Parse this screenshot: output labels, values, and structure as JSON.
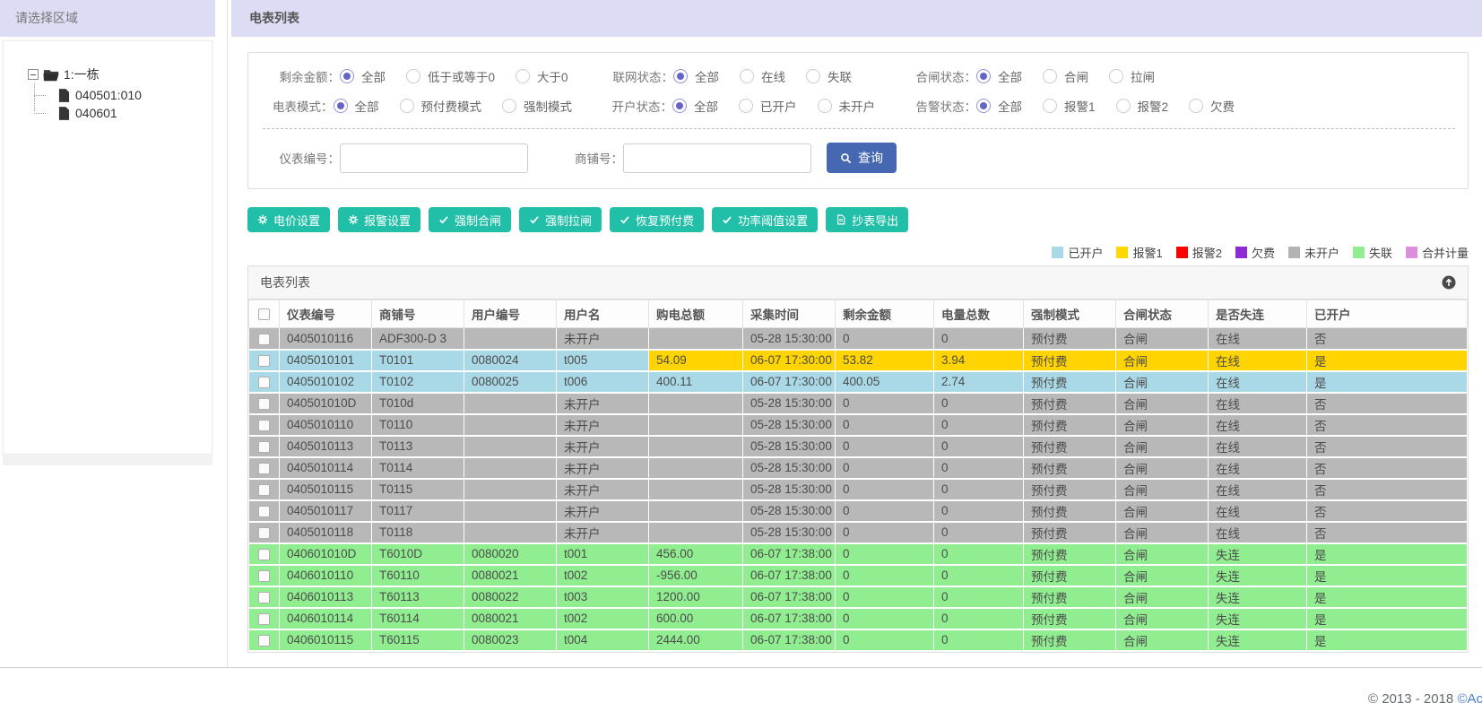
{
  "sidebar": {
    "title": "请选择区域",
    "tree": {
      "root_label": "1:一栋",
      "children": [
        "040501:010",
        "040601"
      ]
    }
  },
  "main_header": {
    "title": "电表列表"
  },
  "filters": {
    "groups": [
      {
        "label": "剩余金额：",
        "options": [
          "全部",
          "低于或等于0",
          "大于0"
        ],
        "selected": 0
      },
      {
        "label": "联网状态：",
        "options": [
          "全部",
          "在线",
          "失联"
        ],
        "selected": 0
      },
      {
        "label": "合闸状态：",
        "options": [
          "全部",
          "合闸",
          "拉闸"
        ],
        "selected": 0
      },
      {
        "label": "电表模式：",
        "options": [
          "全部",
          "预付费模式",
          "强制模式"
        ],
        "selected": 0
      },
      {
        "label": "开户状态：",
        "options": [
          "全部",
          "已开户",
          "未开户"
        ],
        "selected": 0
      },
      {
        "label": "告警状态：",
        "options": [
          "全部",
          "报警1",
          "报警2",
          "欠费"
        ],
        "selected": 0
      }
    ],
    "meter_no_label": "仪表编号：",
    "meter_no_value": "",
    "shop_no_label": "商铺号：",
    "shop_no_value": "",
    "search_label": "查询"
  },
  "toolbar": {
    "buttons": [
      {
        "label": "电价设置",
        "icon": "gear"
      },
      {
        "label": "报警设置",
        "icon": "gear"
      },
      {
        "label": "强制合闸",
        "icon": "check"
      },
      {
        "label": "强制拉闸",
        "icon": "check"
      },
      {
        "label": "恢复预付费",
        "icon": "check"
      },
      {
        "label": "功率阈值设置",
        "icon": "check"
      },
      {
        "label": "抄表导出",
        "icon": "doc"
      }
    ]
  },
  "legend": {
    "items": [
      {
        "label": "已开户",
        "color": "#a9d9e6"
      },
      {
        "label": "报警1",
        "color": "#ffd800"
      },
      {
        "label": "报警2",
        "color": "#fe0000"
      },
      {
        "label": "欠费",
        "color": "#8b2bd6"
      },
      {
        "label": "未开户",
        "color": "#b3b3b3"
      },
      {
        "label": "失联",
        "color": "#90ee90"
      },
      {
        "label": "合并计量",
        "color": "#dd8fdd"
      }
    ]
  },
  "theme": {
    "header_bar": "#dcdcf5",
    "toolbar_button": "#21bfa7",
    "search_button": "#4668b3",
    "radio_accent": "#6565c9",
    "row_gray": "#b8b8b8",
    "row_blue": "#a9d9e6",
    "row_yellow": "#ffd400",
    "row_green": "#90ee90"
  },
  "table": {
    "title": "电表列表",
    "columns": [
      "仪表编号",
      "商铺号",
      "用户编号",
      "用户名",
      "购电总额",
      "采集时间",
      "剩余金额",
      "电量总数",
      "强制模式",
      "合闸状态",
      "是否失连",
      "已开户"
    ],
    "rows": [
      {
        "style": "gray",
        "cells": [
          "0405010116",
          "ADF300-D 3",
          "",
          "未开户",
          "",
          "05-28 15:30:00",
          "0",
          "0",
          "预付费",
          "合闸",
          "在线",
          "否"
        ]
      },
      {
        "style": "blueyellow",
        "cells": [
          "0405010101",
          "T0101",
          "0080024",
          "t005",
          "54.09",
          "06-07 17:30:00",
          "53.82",
          "3.94",
          "预付费",
          "合闸",
          "在线",
          "是"
        ]
      },
      {
        "style": "blue",
        "cells": [
          "0405010102",
          "T0102",
          "0080025",
          "t006",
          "400.11",
          "06-07 17:30:00",
          "400.05",
          "2.74",
          "预付费",
          "合闸",
          "在线",
          "是"
        ]
      },
      {
        "style": "gray",
        "cells": [
          "040501010D",
          "T010d",
          "",
          "未开户",
          "",
          "05-28 15:30:00",
          "0",
          "0",
          "预付费",
          "合闸",
          "在线",
          "否"
        ]
      },
      {
        "style": "gray",
        "cells": [
          "0405010110",
          "T0110",
          "",
          "未开户",
          "",
          "05-28 15:30:00",
          "0",
          "0",
          "预付费",
          "合闸",
          "在线",
          "否"
        ]
      },
      {
        "style": "gray",
        "cells": [
          "0405010113",
          "T0113",
          "",
          "未开户",
          "",
          "05-28 15:30:00",
          "0",
          "0",
          "预付费",
          "合闸",
          "在线",
          "否"
        ]
      },
      {
        "style": "gray",
        "cells": [
          "0405010114",
          "T0114",
          "",
          "未开户",
          "",
          "05-28 15:30:00",
          "0",
          "0",
          "预付费",
          "合闸",
          "在线",
          "否"
        ]
      },
      {
        "style": "gray",
        "cells": [
          "0405010115",
          "T0115",
          "",
          "未开户",
          "",
          "05-28 15:30:00",
          "0",
          "0",
          "预付费",
          "合闸",
          "在线",
          "否"
        ]
      },
      {
        "style": "gray",
        "cells": [
          "0405010117",
          "T0117",
          "",
          "未开户",
          "",
          "05-28 15:30:00",
          "0",
          "0",
          "预付费",
          "合闸",
          "在线",
          "否"
        ]
      },
      {
        "style": "gray",
        "cells": [
          "0405010118",
          "T0118",
          "",
          "未开户",
          "",
          "05-28 15:30:00",
          "0",
          "0",
          "预付费",
          "合闸",
          "在线",
          "否"
        ]
      },
      {
        "style": "green",
        "cells": [
          "040601010D",
          "T6010D",
          "0080020",
          "t001",
          "456.00",
          "06-07 17:38:00",
          "0",
          "0",
          "预付费",
          "合闸",
          "失连",
          "是"
        ]
      },
      {
        "style": "green",
        "cells": [
          "0406010110",
          "T60110",
          "0080021",
          "t002",
          "-956.00",
          "06-07 17:38:00",
          "0",
          "0",
          "预付费",
          "合闸",
          "失连",
          "是"
        ]
      },
      {
        "style": "green",
        "cells": [
          "0406010113",
          "T60113",
          "0080022",
          "t003",
          "1200.00",
          "06-07 17:38:00",
          "0",
          "0",
          "预付费",
          "合闸",
          "失连",
          "是"
        ]
      },
      {
        "style": "green",
        "cells": [
          "0406010114",
          "T60114",
          "0080021",
          "t002",
          "600.00",
          "06-07 17:38:00",
          "0",
          "0",
          "预付费",
          "合闸",
          "失连",
          "是"
        ]
      },
      {
        "style": "green",
        "cells": [
          "0406010115",
          "T60115",
          "0080023",
          "t004",
          "2444.00",
          "06-07 17:38:00",
          "0",
          "0",
          "预付费",
          "合闸",
          "失连",
          "是"
        ]
      }
    ]
  },
  "footer": {
    "copyright": "© 2013 - 2018 ",
    "brand": "©Acr"
  }
}
